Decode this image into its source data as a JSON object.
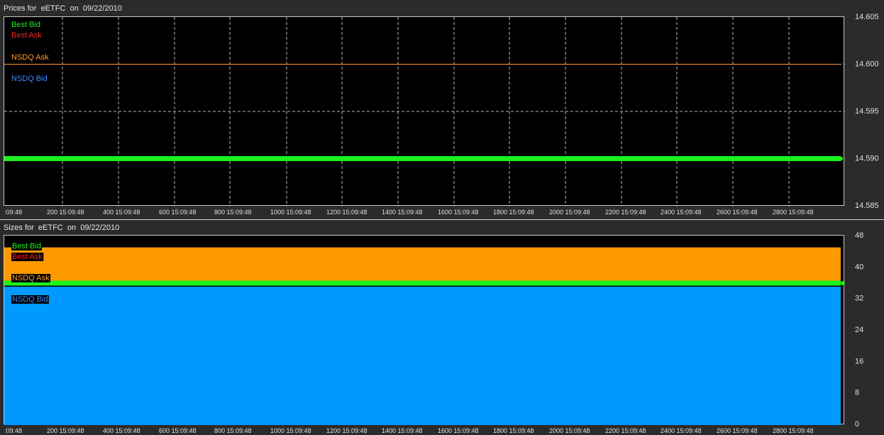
{
  "colors": {
    "best_bid": "#1bf21b",
    "best_ask": "#ff1f1f",
    "nsdq_ask": "#ff9a33",
    "nsdq_bid": "#3b8bff",
    "size_ask_fill": "#ff9900",
    "size_bid_fill": "#0099ff",
    "grid": "#b8b8b8"
  },
  "chart_data": [
    {
      "type": "line",
      "title": "Prices for  eETFC  on  09/22/2010",
      "legend": [
        "Best Bid",
        "Best Ask",
        "NSDQ Ask",
        "NSDQ Bid"
      ],
      "legend_placement": "top-left",
      "x_tick_labels": [
        ":09:48",
        "200 15:09:48",
        "400 15:09:48",
        "600 15:09:48",
        "800 15:09:48",
        "1000 15:09:48",
        "1200 15:09:48",
        "1400 15:09:48",
        "1600 15:09:48",
        "1800 15:09:48",
        "2000 15:09:48",
        "2200 15:09:48",
        "2400 15:09:48",
        "2600 15:09:48",
        "2800 15:09:48"
      ],
      "y_tick_labels": [
        "14.605",
        "14.600",
        "14.595",
        "14.590",
        "14.585"
      ],
      "xlim": [
        0,
        2950
      ],
      "ylim": [
        14.585,
        14.605
      ],
      "y_ticks": [
        14.605,
        14.6,
        14.595,
        14.59,
        14.585
      ],
      "grid": true,
      "series": [
        {
          "name": "Best Bid",
          "x": [
            0,
            2950
          ],
          "y": [
            14.59,
            14.59
          ]
        },
        {
          "name": "NSDQ Ask",
          "x": [
            0,
            2950
          ],
          "y": [
            14.6,
            14.6
          ]
        }
      ]
    },
    {
      "type": "area",
      "title": "Sizes for  eETFC  on  09/22/2010",
      "legend": [
        "Best Bid",
        "Best Ask",
        "NSDQ Ask",
        "NSDQ Bid"
      ],
      "legend_placement": "top-left",
      "x_tick_labels": [
        ":09:48",
        "200 15:09:48",
        "400 15:09:48",
        "600 15:09:48",
        "800 15:09:48",
        "1000 15:09:48",
        "1200 15:09:48",
        "1400 15:09:48",
        "1600 15:09:48",
        "1800 15:09:48",
        "2000 15:09:48",
        "2200 15:09:48",
        "2400 15:09:48",
        "2600 15:09:48",
        "2800 15:09:48"
      ],
      "y_tick_labels": [
        "48",
        "40",
        "32",
        "24",
        "16",
        "8",
        "0"
      ],
      "xlim": [
        0,
        2950
      ],
      "ylim": [
        0,
        48
      ],
      "y_ticks": [
        48,
        40,
        32,
        24,
        16,
        8,
        0
      ],
      "grid": false,
      "series": [
        {
          "name": "NSDQ Ask",
          "x": [
            0,
            2950
          ],
          "y": [
            45,
            45
          ]
        },
        {
          "name": "Best Bid",
          "x": [
            0,
            2950
          ],
          "y": [
            36,
            36
          ]
        },
        {
          "name": "NSDQ Bid",
          "x": [
            0,
            2950
          ],
          "y": [
            35,
            35
          ]
        }
      ]
    }
  ]
}
